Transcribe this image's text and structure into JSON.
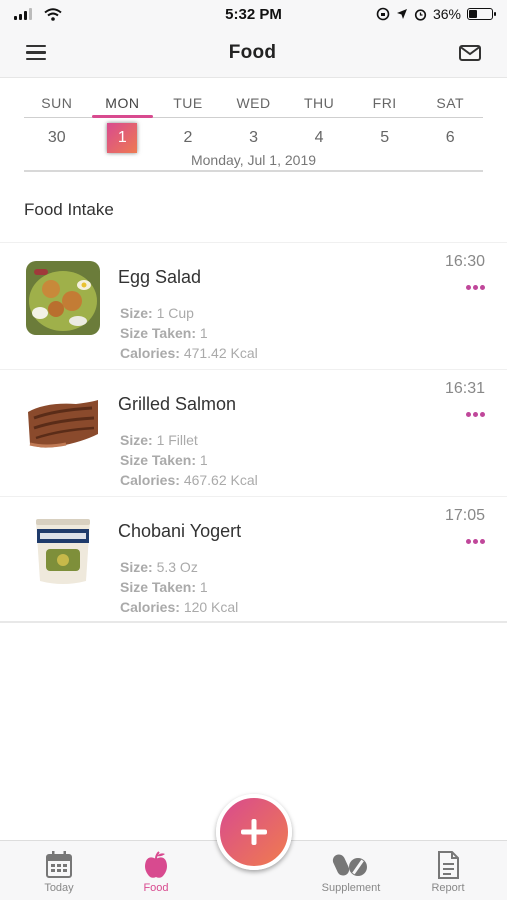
{
  "status_bar": {
    "time": "5:32 PM",
    "battery": "36%",
    "battery_level": 0.36
  },
  "header": {
    "title": "Food",
    "menu_icon": "hamburger-icon",
    "mail_icon": "mail-icon"
  },
  "week": {
    "days": [
      {
        "day": "SUN",
        "date": "30"
      },
      {
        "day": "MON",
        "date": "1"
      },
      {
        "day": "TUE",
        "date": "2"
      },
      {
        "day": "WED",
        "date": "3"
      },
      {
        "day": "THU",
        "date": "4"
      },
      {
        "day": "FRI",
        "date": "5"
      },
      {
        "day": "SAT",
        "date": "6"
      }
    ],
    "selected_index": 1,
    "full_date": "Monday, Jul 1, 2019"
  },
  "section_title": "Food Intake",
  "foods": [
    {
      "name": "Egg Salad",
      "time": "16:30",
      "size_label": "Size:",
      "size": "1 Cup",
      "taken_label": "Size Taken:",
      "taken": "1",
      "calories_label": "Calories:",
      "calories": "471.42 Kcal"
    },
    {
      "name": "Grilled Salmon",
      "time": "16:31",
      "size_label": "Size:",
      "size": "1 Fillet",
      "taken_label": "Size Taken:",
      "taken": "1",
      "calories_label": "Calories:",
      "calories": "467.62 Kcal"
    },
    {
      "name": "Chobani Yogert",
      "time": "17:05",
      "size_label": "Size:",
      "size": "5.3 Oz",
      "taken_label": "Size Taken:",
      "taken": "1",
      "calories_label": "Calories:",
      "calories": "120 Kcal"
    }
  ],
  "tabs": [
    {
      "label": "Today",
      "icon": "calendar-icon"
    },
    {
      "label": "Food",
      "icon": "apple-icon"
    },
    {
      "label": "Supplement",
      "icon": "pills-icon"
    },
    {
      "label": "Report",
      "icon": "document-icon"
    }
  ],
  "fab_icon": "plus-icon",
  "colors": {
    "accent": "#d84a8f",
    "accent_end": "#ee7a52",
    "dots": "#c0479a"
  }
}
